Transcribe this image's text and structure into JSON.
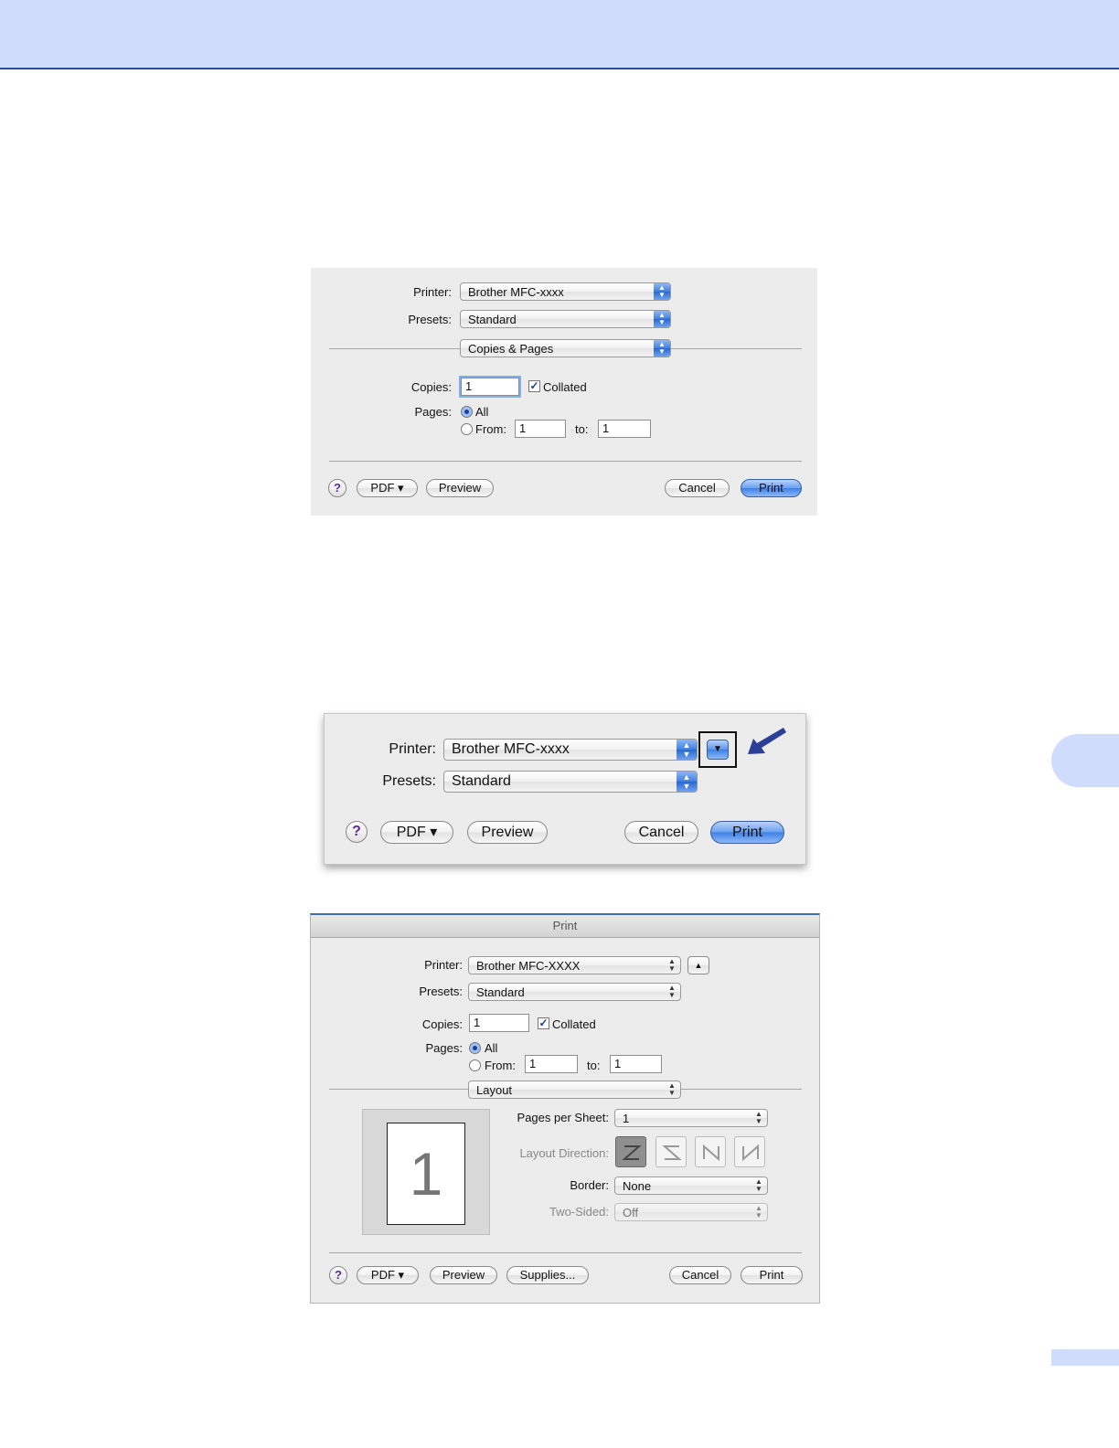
{
  "dialog1": {
    "printer_label": "Printer:",
    "printer_value": "Brother MFC-xxxx",
    "presets_label": "Presets:",
    "presets_value": "Standard",
    "pane_value": "Copies & Pages",
    "copies_label": "Copies:",
    "copies_value": "1",
    "collated_label": "Collated",
    "pages_label": "Pages:",
    "all_label": "All",
    "from_label": "From:",
    "from_value": "1",
    "to_label": "to:",
    "to_value": "1",
    "help_label": "?",
    "pdf_label": "PDF ▾",
    "preview_label": "Preview",
    "cancel_label": "Cancel",
    "print_label": "Print"
  },
  "dialog2": {
    "printer_label": "Printer:",
    "printer_value": "Brother MFC-xxxx",
    "presets_label": "Presets:",
    "presets_value": "Standard",
    "help_label": "?",
    "pdf_label": "PDF ▾",
    "preview_label": "Preview",
    "cancel_label": "Cancel",
    "print_label": "Print"
  },
  "dialog3": {
    "window_title": "Print",
    "printer_label": "Printer:",
    "printer_value": "Brother MFC-XXXX",
    "presets_label": "Presets:",
    "presets_value": "Standard",
    "copies_label": "Copies:",
    "copies_value": "1",
    "collated_label": "Collated",
    "pages_label": "Pages:",
    "all_label": "All",
    "from_label": "From:",
    "from_value": "1",
    "to_label": "to:",
    "to_value": "1",
    "pane_value": "Layout",
    "thumb_number": "1",
    "pages_per_sheet_label": "Pages per Sheet:",
    "pages_per_sheet_value": "1",
    "layout_direction_label": "Layout Direction:",
    "border_label": "Border:",
    "border_value": "None",
    "two_sided_label": "Two-Sided:",
    "two_sided_value": "Off",
    "help_label": "?",
    "pdf_label": "PDF ▾",
    "preview_label": "Preview",
    "supplies_label": "Supplies...",
    "cancel_label": "Cancel",
    "print_label": "Print"
  },
  "colors": {
    "header_band": "#cfdcfb",
    "header_rule": "#2c4aa0",
    "accent_arrow": "#2b3f96"
  }
}
